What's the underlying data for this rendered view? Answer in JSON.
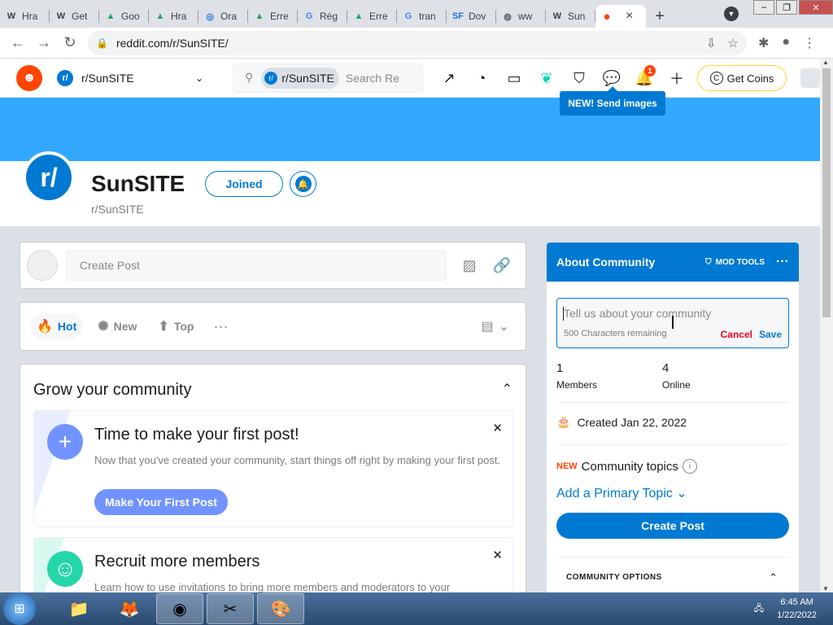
{
  "browser": {
    "tabs": [
      {
        "fav": "W",
        "label": "Hra"
      },
      {
        "fav": "W",
        "label": "Get"
      },
      {
        "fav": "▲",
        "label": "Goo"
      },
      {
        "fav": "▲",
        "label": "Hra"
      },
      {
        "fav": "◎",
        "label": "Ora"
      },
      {
        "fav": "▲",
        "label": "Erre"
      },
      {
        "fav": "G",
        "label": "Rég"
      },
      {
        "fav": "▲",
        "label": "Erre"
      },
      {
        "fav": "G",
        "label": "tran"
      },
      {
        "fav": "SF",
        "label": "Dov"
      },
      {
        "fav": "◍",
        "label": "ww"
      },
      {
        "fav": "W",
        "label": "Sun"
      }
    ],
    "active_tab_fav": "●",
    "active_tab_close": "×",
    "new_tab": "+",
    "url": "reddit.com/r/SunSITE/"
  },
  "header": {
    "community_selector": "r/SunSITE",
    "search_chip": "r/SunSITE",
    "search_placeholder": "Search Re",
    "notification_count": "1",
    "get_coins": "Get Coins",
    "tooltip": "NEW! Send images"
  },
  "community": {
    "icon_text": "r/",
    "name": "SunSITE",
    "subname": "r/SunSITE",
    "joined_label": "Joined"
  },
  "create_post": {
    "placeholder": "Create Post"
  },
  "sort": {
    "hot": "Hot",
    "new": "New",
    "top": "Top",
    "more": "···"
  },
  "grow": {
    "title": "Grow your community",
    "tasks": [
      {
        "title": "Time to make your first post!",
        "desc": "Now that you've created your community, start things off right by making your first post.",
        "button": "Make Your First Post"
      },
      {
        "title": "Recruit more members",
        "desc": "Learn how to use invitations to bring more members and moderators to your"
      }
    ]
  },
  "about": {
    "title": "About Community",
    "mod_tools": "MOD TOOLS",
    "description_placeholder": "Tell us about your community",
    "chars_remaining": "500 Characters remaining",
    "cancel": "Cancel",
    "save": "Save",
    "members_count": "1",
    "members_label": "Members",
    "online_count": "4",
    "online_label": "Online",
    "created": "Created Jan 22, 2022",
    "topics_new": "NEW",
    "topics_label": "Community topics",
    "add_topic": "Add a Primary Topic",
    "create_post": "Create Post",
    "community_options": "COMMUNITY OPTIONS"
  },
  "taskbar": {
    "time": "6:45 AM",
    "date": "1/22/2022"
  },
  "colors": {
    "reddit_orange": "#ff4500",
    "reddit_blue": "#0079d3",
    "banner": "#33a8ff",
    "make_post_button": "#7193ff",
    "recruit_icon": "#24d6a8"
  }
}
